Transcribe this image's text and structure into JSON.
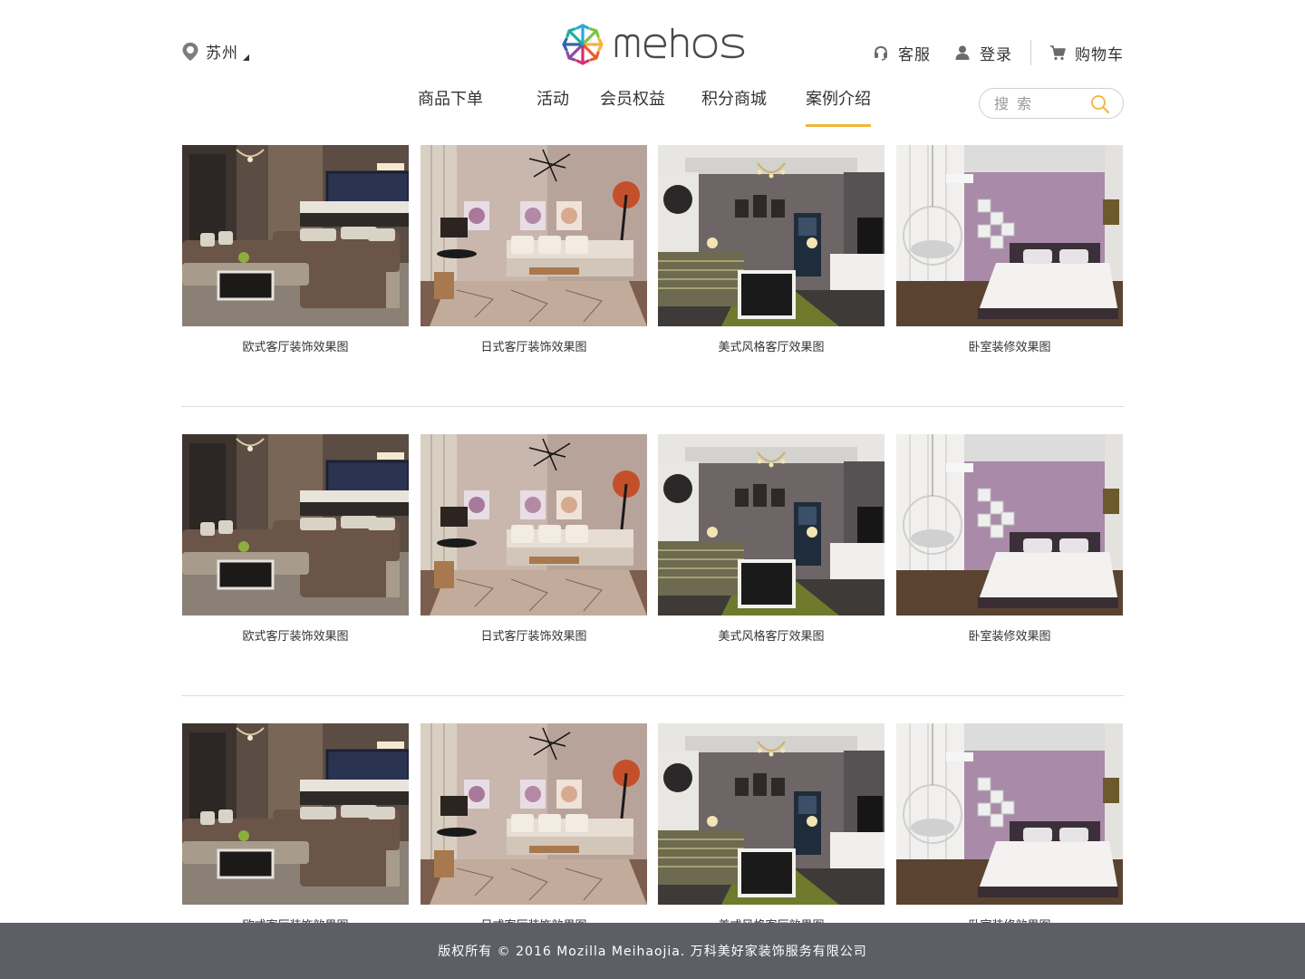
{
  "header": {
    "city": "苏州",
    "logo_text": "mehos",
    "service_label": "客服",
    "login_label": "登录",
    "cart_label": "购物车"
  },
  "nav": {
    "items": [
      {
        "label": "商品下单"
      },
      {
        "label": "活动"
      },
      {
        "label": "会员权益"
      },
      {
        "label": "积分商城"
      },
      {
        "label": "案例介绍",
        "active": true
      }
    ]
  },
  "search": {
    "placeholder": "搜 索"
  },
  "gallery": {
    "rows": [
      {
        "cards": [
          {
            "caption": "欧式客厅装饰效果图",
            "scene": "european-living-room"
          },
          {
            "caption": "日式客厅装饰效果图",
            "scene": "japanese-living-room"
          },
          {
            "caption": "美式风格客厅效果图",
            "scene": "american-living-room"
          },
          {
            "caption": "卧室装修效果图",
            "scene": "bedroom"
          }
        ]
      },
      {
        "cards": [
          {
            "caption": "欧式客厅装饰效果图",
            "scene": "european-living-room"
          },
          {
            "caption": "日式客厅装饰效果图",
            "scene": "japanese-living-room"
          },
          {
            "caption": "美式风格客厅效果图",
            "scene": "american-living-room"
          },
          {
            "caption": "卧室装修效果图",
            "scene": "bedroom"
          }
        ]
      },
      {
        "cards": [
          {
            "caption": "欧式客厅装饰效果图",
            "scene": "european-living-room"
          },
          {
            "caption": "日式客厅装饰效果图",
            "scene": "japanese-living-room"
          },
          {
            "caption": "美式风格客厅效果图",
            "scene": "american-living-room"
          },
          {
            "caption": "卧室装修效果图",
            "scene": "bedroom"
          }
        ]
      }
    ]
  },
  "footer": {
    "copyright": "版权所有 © 2016 Mozilla Meihaojia. 万科美好家装饰服务有限公司"
  },
  "colors": {
    "accent": "#f2b53a",
    "footer_bg": "#5d5f66",
    "divider": "#dcdcdc"
  }
}
